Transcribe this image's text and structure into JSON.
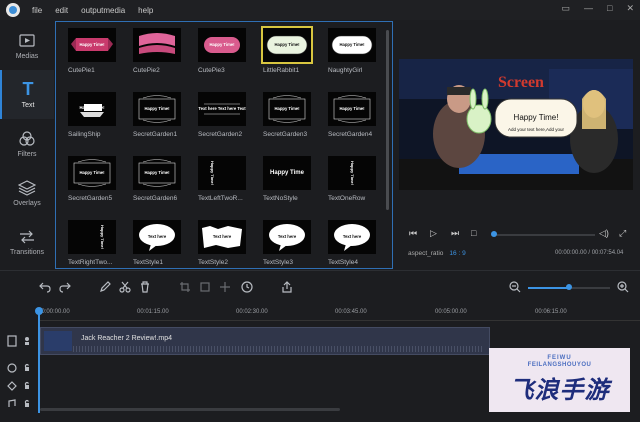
{
  "menu": [
    "file",
    "edit",
    "outputmedia",
    "help"
  ],
  "nav": [
    {
      "label": "Medias",
      "icon": "media-icon",
      "active": false
    },
    {
      "label": "Text",
      "icon": "text-icon",
      "active": true
    },
    {
      "label": "Filters",
      "icon": "filters-icon",
      "active": false
    },
    {
      "label": "Overlays",
      "icon": "overlays-icon",
      "active": false
    },
    {
      "label": "Transitions",
      "icon": "transitions-icon",
      "active": false
    }
  ],
  "library": {
    "items": [
      {
        "name": "CutePie1",
        "preview": "Happy Time!"
      },
      {
        "name": "CutePie2",
        "preview": ""
      },
      {
        "name": "CutePie3",
        "preview": "Happy Time!"
      },
      {
        "name": "LittleRabbit1",
        "preview": "Happy Time!"
      },
      {
        "name": "NaughtyGirl",
        "preview": "Happy Time!"
      },
      {
        "name": "SailingShip",
        "preview": "Happy Time!"
      },
      {
        "name": "SecretGarden1",
        "preview": "Happy Time!"
      },
      {
        "name": "SecretGarden2",
        "preview": "Text here Text here Text"
      },
      {
        "name": "SecretGarden3",
        "preview": "Happy Time!"
      },
      {
        "name": "SecretGarden4",
        "preview": "Happy Time!"
      },
      {
        "name": "SecretGarden5",
        "preview": "Happy Time!"
      },
      {
        "name": "SecretGarden6",
        "preview": "Happy Time!"
      },
      {
        "name": "TextLeftTwoR...",
        "preview": "Happy Time!"
      },
      {
        "name": "TextNoStyle",
        "preview": "Happy Time"
      },
      {
        "name": "TextOneRow",
        "preview": "Happy Time!"
      },
      {
        "name": "TextRightTwo...",
        "preview": "Happy Time!"
      },
      {
        "name": "TextStyle1",
        "preview": "Text here"
      },
      {
        "name": "TextStyle2",
        "preview": "Text here"
      },
      {
        "name": "TextStyle3",
        "preview": "Text here"
      },
      {
        "name": "TextStyle4",
        "preview": "Text here"
      }
    ],
    "selected": 3
  },
  "preview": {
    "banner": "Screen",
    "bubble_title": "Happy Time!",
    "bubble_sub": "Add your text here,Add your",
    "aspect_label": "aspect_ratio",
    "aspect_value": "16 : 9",
    "time": "00:00:00.00 / 00:07:54.04",
    "progress": 0.0
  },
  "timeline": {
    "ticks": [
      "00:00:00.00",
      "00:01:15.00",
      "00:02:30.00",
      "00:03:45.00",
      "00:05:00.00",
      "00:06:15.00"
    ],
    "clip": "Jack Reacher 2 Review!.mp4",
    "zoom": 0.5
  },
  "watermark": {
    "line1": "FEIWU",
    "line2": "FEILANGSHOUYOU",
    "line3": "飞浪手游"
  },
  "colors": {
    "accent": "#3c94e4",
    "selected": "#d8c640"
  }
}
